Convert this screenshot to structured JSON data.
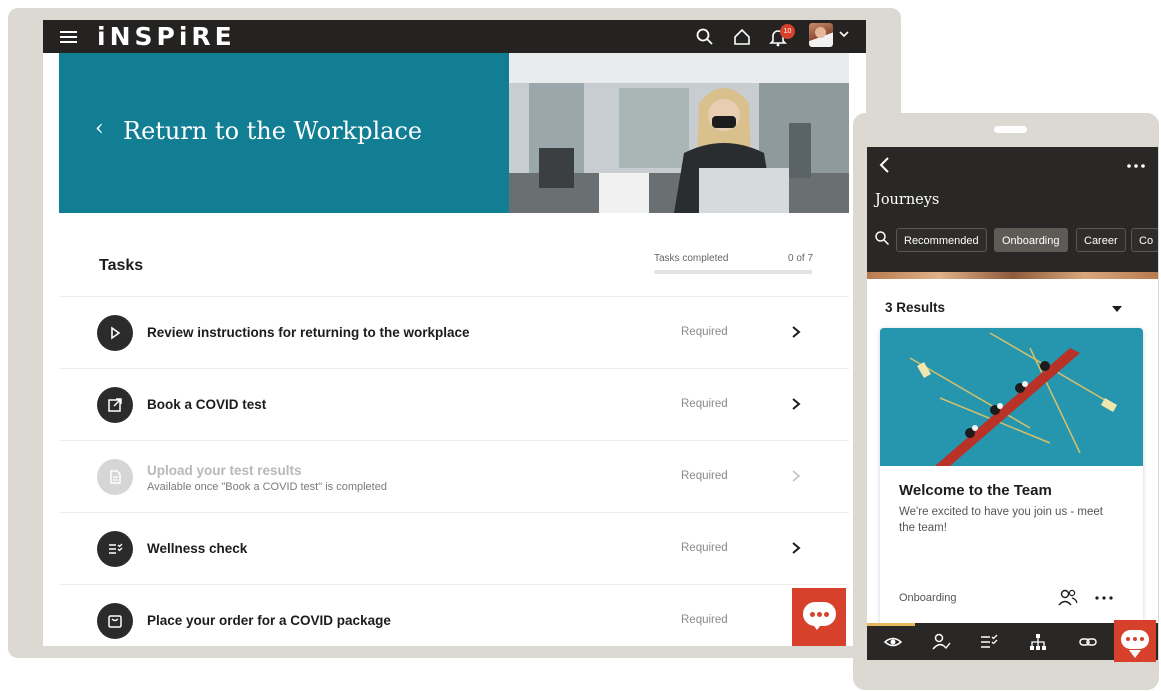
{
  "tablet": {
    "brand": "iNSPiRE",
    "notification_count": "10",
    "page_title": "Return to the Workplace",
    "tasks": {
      "heading": "Tasks",
      "completed_label": "Tasks completed",
      "completed_count": "0 of 7",
      "progress_fraction": 0,
      "items": [
        {
          "title": "Review instructions for returning to the workplace",
          "subtitle": "",
          "status": "Required",
          "icon": "play-icon",
          "enabled": true
        },
        {
          "title": "Book a COVID test",
          "subtitle": "",
          "status": "Required",
          "icon": "external-link-icon",
          "enabled": true
        },
        {
          "title": "Upload your test results",
          "subtitle": "Available once \"Book a COVID test\" is completed",
          "status": "Required",
          "icon": "document-icon",
          "enabled": false
        },
        {
          "title": "Wellness check",
          "subtitle": "",
          "status": "Required",
          "icon": "checklist-icon",
          "enabled": true
        },
        {
          "title": "Place your order for a COVID package",
          "subtitle": "",
          "status": "Required",
          "icon": "package-icon",
          "enabled": true
        }
      ]
    }
  },
  "phone": {
    "title": "Journeys",
    "chips": [
      "Recommended",
      "Onboarding",
      "Career",
      "Co"
    ],
    "active_chip": "Onboarding",
    "results_label": "3 Results",
    "card": {
      "title": "Welcome to the Team",
      "description": "We're excited to have you join us - meet the team!",
      "tag": "Onboarding"
    },
    "nav_icons": [
      "eye-icon",
      "person-check-icon",
      "checklist-icon",
      "org-chart-icon",
      "link-icon",
      "chat-icon"
    ]
  },
  "colors": {
    "topbar": "#242322",
    "hero": "#127e94",
    "accent_red": "#d7412c",
    "nav_accent": "#e7b75b"
  }
}
